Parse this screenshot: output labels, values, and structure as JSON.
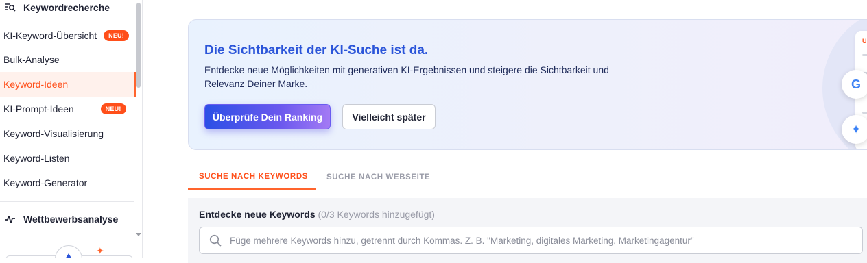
{
  "sidebar": {
    "keyword_section": "Keywordrecherche",
    "items": [
      {
        "label": "KI-Keyword-Übersicht",
        "badge": "NEU!"
      },
      {
        "label": "Bulk-Analyse"
      },
      {
        "label": "Keyword-Ideen",
        "active": true
      },
      {
        "label": "KI-Prompt-Ideen",
        "badge": "NEU!"
      },
      {
        "label": "Keyword-Visualisierung"
      },
      {
        "label": "Keyword-Listen"
      },
      {
        "label": "Keyword-Generator"
      }
    ],
    "competitor_section": "Wettbewerbsanalyse"
  },
  "banner": {
    "title": "Die Sichtbarkeit der KI-Suche ist da.",
    "text": "Entdecke neue Möglichkeiten mit generativen KI-Ergebnissen und steigere die Sichtbarkeit und Relevanz Deiner Marke.",
    "primary_button": "Überprüfe Dein Ranking",
    "secondary_button": "Vielleicht später",
    "card_letter": "U",
    "google_letter": "G"
  },
  "tabs": [
    {
      "label": "SUCHE NACH KEYWORDS",
      "active": true
    },
    {
      "label": "SUCHE NACH WEBSEITE"
    }
  ],
  "search": {
    "label": "Entdecke neue Keywords",
    "count": "(0/3 Keywords hinzugefügt)",
    "placeholder": "Füge mehrere Keywords hinzu, getrennt durch Kommas. Z. B. \"Marketing, digitales Marketing, Marketingagentur\""
  },
  "colors": {
    "accent": "#ff642d",
    "banner_title": "#2b55d9",
    "primary_btn_start": "#2c50e6",
    "primary_btn_end": "#a37af4"
  }
}
